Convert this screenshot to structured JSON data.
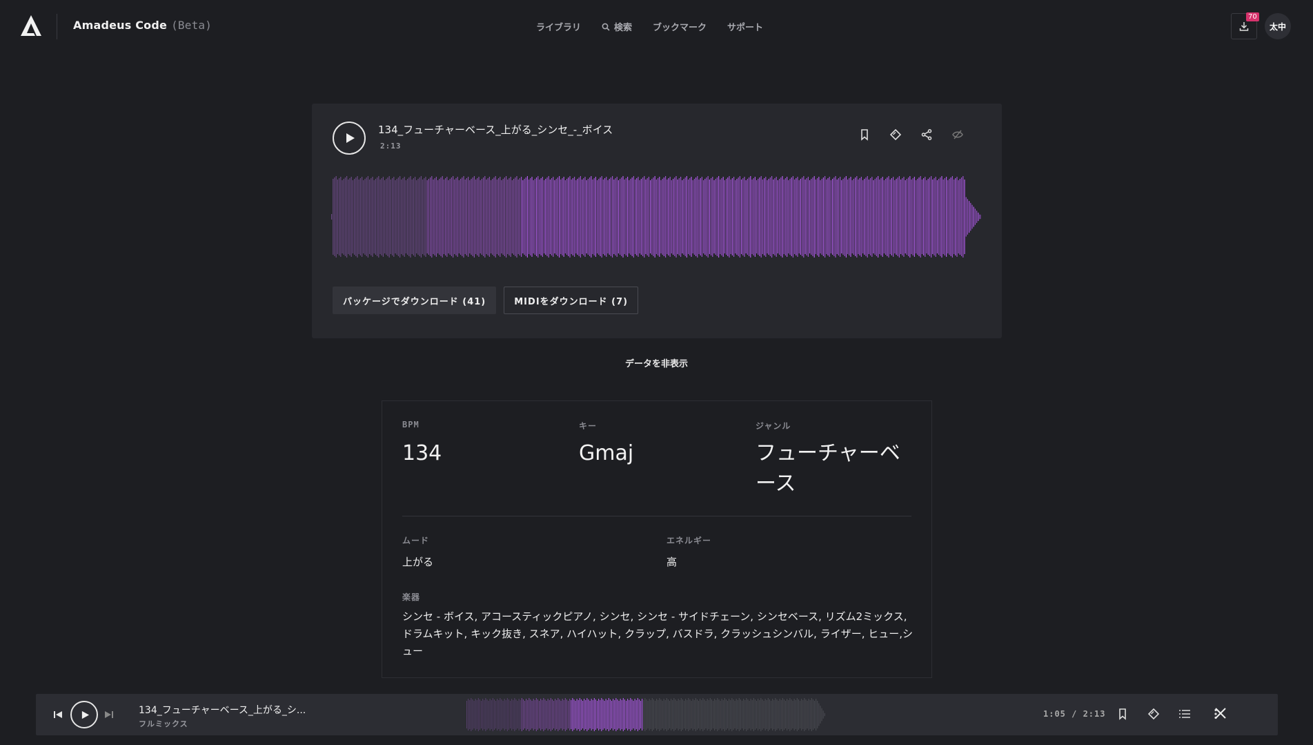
{
  "header": {
    "app_title": "Amadeus Code",
    "beta_label": "(Beta)",
    "nav": [
      {
        "label": "ライブラリ"
      },
      {
        "label": "検索",
        "icon": "search-icon"
      },
      {
        "label": "ブックマーク"
      },
      {
        "label": "サポート"
      }
    ],
    "download_badge": "70",
    "avatar_initials": "太中"
  },
  "track": {
    "title": "134_フューチャーベース_上がる_シンセ_-_ボイス",
    "duration": "2:13",
    "actions": [
      "bookmark-icon",
      "variation-icon",
      "share-icon",
      "hide-icon"
    ],
    "package_download_label": "パッケージでダウンロード (41)",
    "midi_download_label": "MIDIをダウンロード (7)",
    "waveform_colors": {
      "dim": "#6b4a86",
      "mid": "#8a4fb0",
      "bright": "#b45cf0"
    }
  },
  "hide_data_label": "データを非表示",
  "data": {
    "bpm_label": "BPM",
    "bpm": "134",
    "key_label": "キー",
    "key": "Gmaj",
    "genre_label": "ジャンル",
    "genre": "フューチャーベース",
    "mood_label": "ムード",
    "mood": "上がる",
    "energy_label": "エネルギー",
    "energy": "高",
    "instruments_label": "楽器",
    "instruments": "シンセ - ボイス, アコースティックピアノ, シンセ, シンセ - サイドチェーン, シンセベース, リズム2ミックス, ドラムキット, キック抜き, スネア, ハイハット, クラップ, バスドラ, クラッシュシンバル, ライザー, ヒュー,シュー"
  },
  "player": {
    "title": "134_フューチャーベース_上がる_シ...",
    "subtitle": "フルミックス",
    "time": "1:05 / 2:13",
    "progress": 0.49
  }
}
